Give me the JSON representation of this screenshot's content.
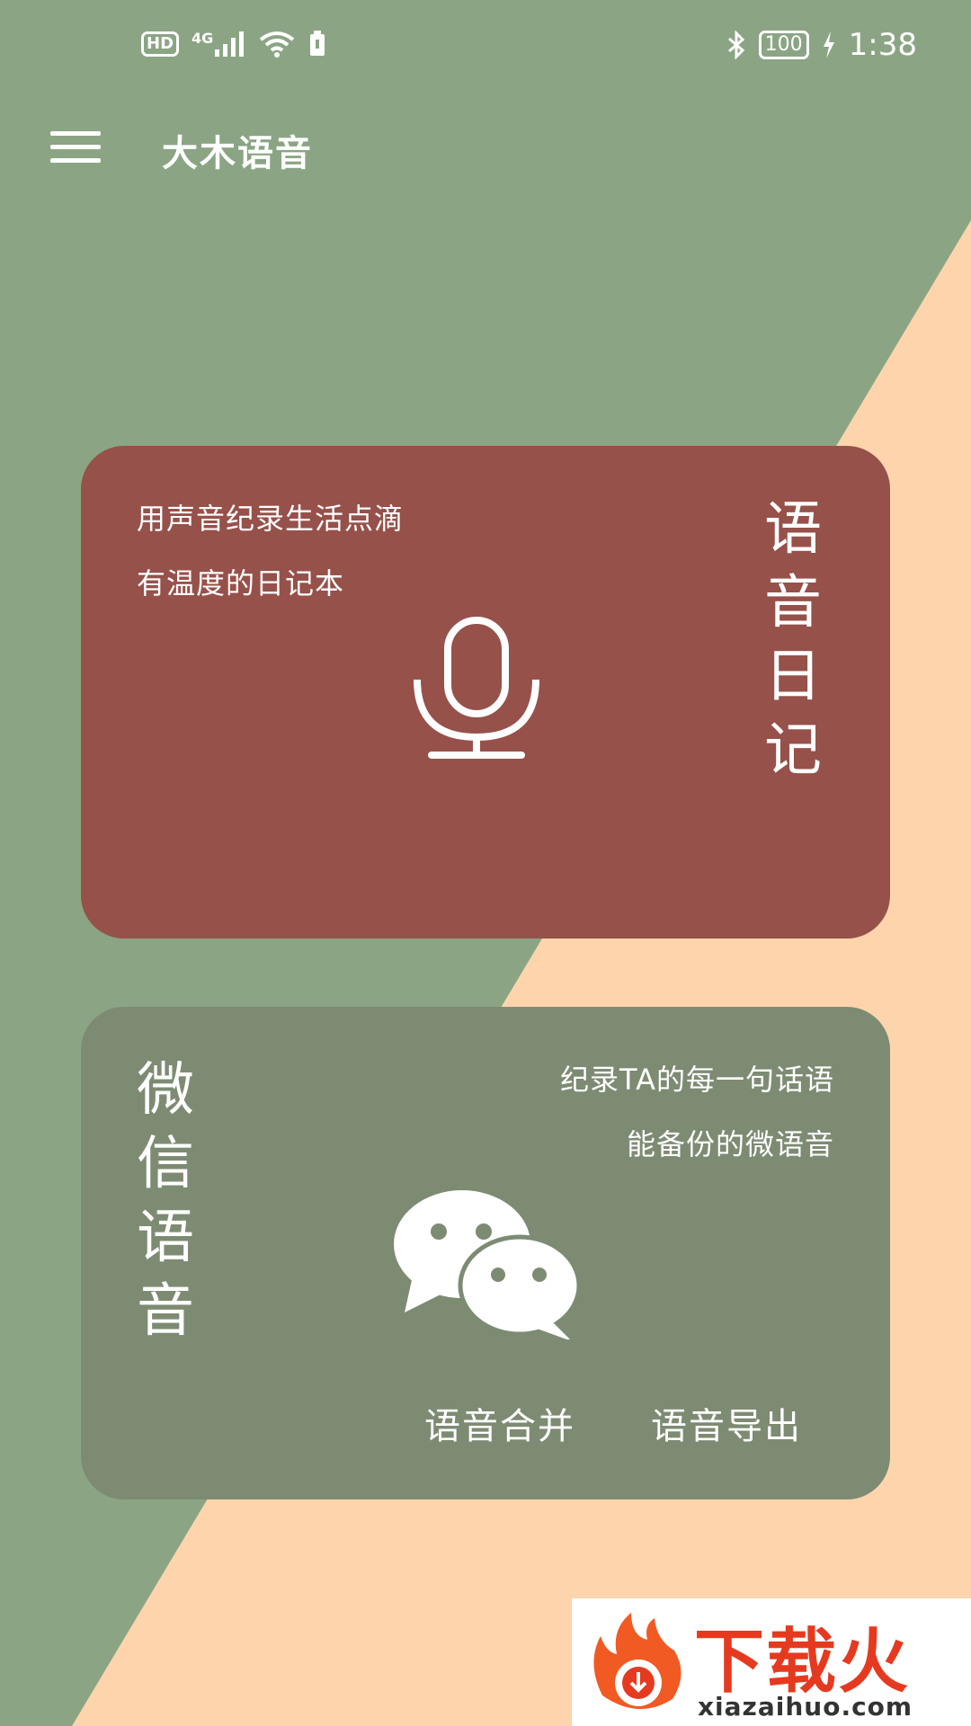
{
  "colors": {
    "background_green": "#8BA584",
    "background_peach": "#FDD4AC",
    "diary_card": "#96514A",
    "wechat_card": "#7D8B73",
    "text": "#FFFFFF"
  },
  "status_bar": {
    "network_badge": "HD",
    "network_type": "4G",
    "battery": "100",
    "time": "1:38",
    "icons": [
      "hd-icon",
      "signal-icon",
      "wifi-icon",
      "sim-icon",
      "bluetooth-icon",
      "battery-icon",
      "charging-icon"
    ]
  },
  "top_bar": {
    "menu_icon": "menu-icon",
    "title": "大木语音"
  },
  "diary_card": {
    "line1": "用声音纪录生活点滴",
    "line2": "有温度的日记本",
    "title_chars": [
      "语",
      "音",
      "日",
      "记"
    ],
    "icon": "microphone-icon"
  },
  "wechat_card": {
    "line1": "纪录TA的每一句话语",
    "line2": "能备份的微语音",
    "title_chars": [
      "微",
      "信",
      "语",
      "音"
    ],
    "icon": "wechat-icon",
    "actions": [
      "语音合并",
      "语音导出"
    ]
  },
  "watermark": {
    "text": "下载火",
    "domain": "xiazaihuo.com"
  }
}
